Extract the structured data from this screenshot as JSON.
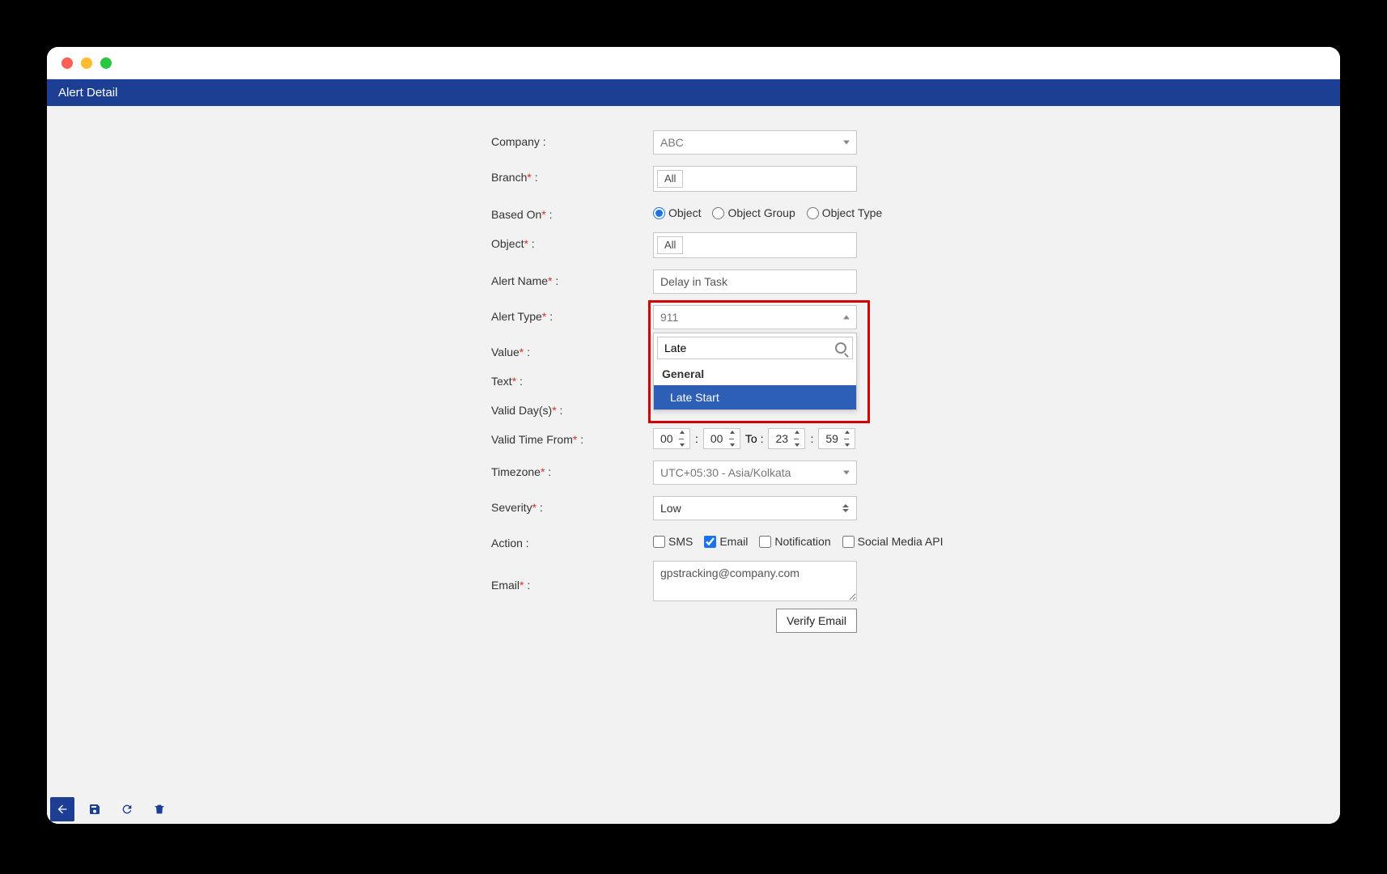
{
  "window": {
    "panel_title": "Alert Detail"
  },
  "labels": {
    "company": "Company :",
    "branch": "Branch",
    "branch_suffix": " :",
    "based_on": "Based On",
    "object": "Object",
    "alert_name": "Alert Name",
    "alert_type": "Alert Type",
    "value": "Value",
    "text": "Text",
    "valid_days": "Valid Day(s)",
    "valid_time_from": "Valid Time From",
    "to": "To :",
    "timezone": "Timezone",
    "severity": "Severity",
    "action": "Action :",
    "email": "Email",
    "colon": " :",
    "asterisk": "*"
  },
  "form": {
    "company": "ABC",
    "branch_tag": "All",
    "based_on_options": {
      "obj": "Object",
      "group": "Object Group",
      "type": "Object Type"
    },
    "based_on_selected": "obj",
    "object_tag": "All",
    "alert_name": "Delay in Task",
    "alert_type_selected": "911",
    "alert_type_search": "Late",
    "alert_type_group": "General",
    "alert_type_option": "Late Start",
    "time_from_h": "00",
    "time_from_m": "00",
    "time_to_h": "23",
    "time_to_m": "59",
    "timezone": "UTC+05:30 - Asia/Kolkata",
    "severity": "Low",
    "actions": {
      "sms": "SMS",
      "email": "Email",
      "notification": "Notification",
      "social": "Social Media API"
    },
    "actions_checked": {
      "sms": false,
      "email": true,
      "notification": false,
      "social": false
    },
    "email_value": "gpstracking@company.com",
    "verify_btn": "Verify Email"
  },
  "footer": {
    "back": "back-icon",
    "save": "save-icon",
    "refresh": "refresh-icon",
    "delete": "trash-icon"
  }
}
